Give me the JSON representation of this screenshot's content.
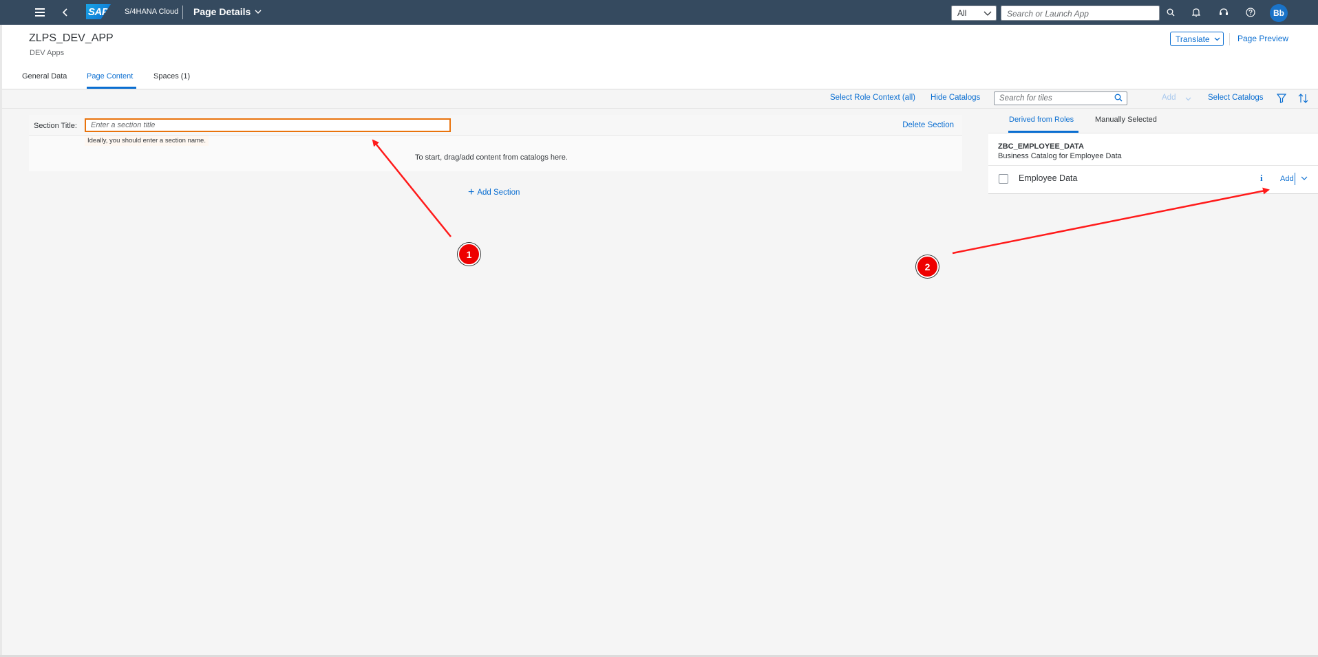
{
  "shell": {
    "logo_text": "SAP",
    "product": "S/4HANA Cloud",
    "title": "Page Details",
    "scope": "All",
    "search_placeholder": "Search or Launch App",
    "avatar_initials": "Bb",
    "icons": [
      "menu-icon",
      "back-icon",
      "search-icon",
      "bell-icon",
      "help-center-icon",
      "question-icon"
    ],
    "bg_color": "#354a5f"
  },
  "header": {
    "title": "ZLPS_DEV_APP",
    "subtitle": "DEV Apps",
    "translate_label": "Translate",
    "preview_label": "Page Preview",
    "tabs": [
      {
        "label": "General Data"
      },
      {
        "label": "Page Content"
      },
      {
        "label": "Spaces (1)"
      }
    ]
  },
  "toolbar": {
    "role_context": "Select Role Context (all)",
    "hide_catalogs": "Hide Catalogs",
    "search_placeholder": "Search for tiles",
    "add_label": "Add",
    "select_catalogs": "Select Catalogs"
  },
  "section": {
    "label": "Section Title:",
    "placeholder": "Enter a section title",
    "warning": "Ideally, you should enter a section name.",
    "delete_label": "Delete Section",
    "empty_text": "To start, drag/add content from catalogs here.",
    "add_section": "Add Section"
  },
  "catalog_panel": {
    "tabs": [
      {
        "label": "Derived from Roles"
      },
      {
        "label": "Manually Selected"
      }
    ],
    "catalog_id": "ZBC_EMPLOYEE_DATA",
    "catalog_desc": "Business Catalog for Employee Data",
    "row_label": "Employee Data",
    "row_add": "Add"
  },
  "annotations": {
    "markers": [
      "1",
      "2"
    ],
    "color": "#e00000"
  }
}
